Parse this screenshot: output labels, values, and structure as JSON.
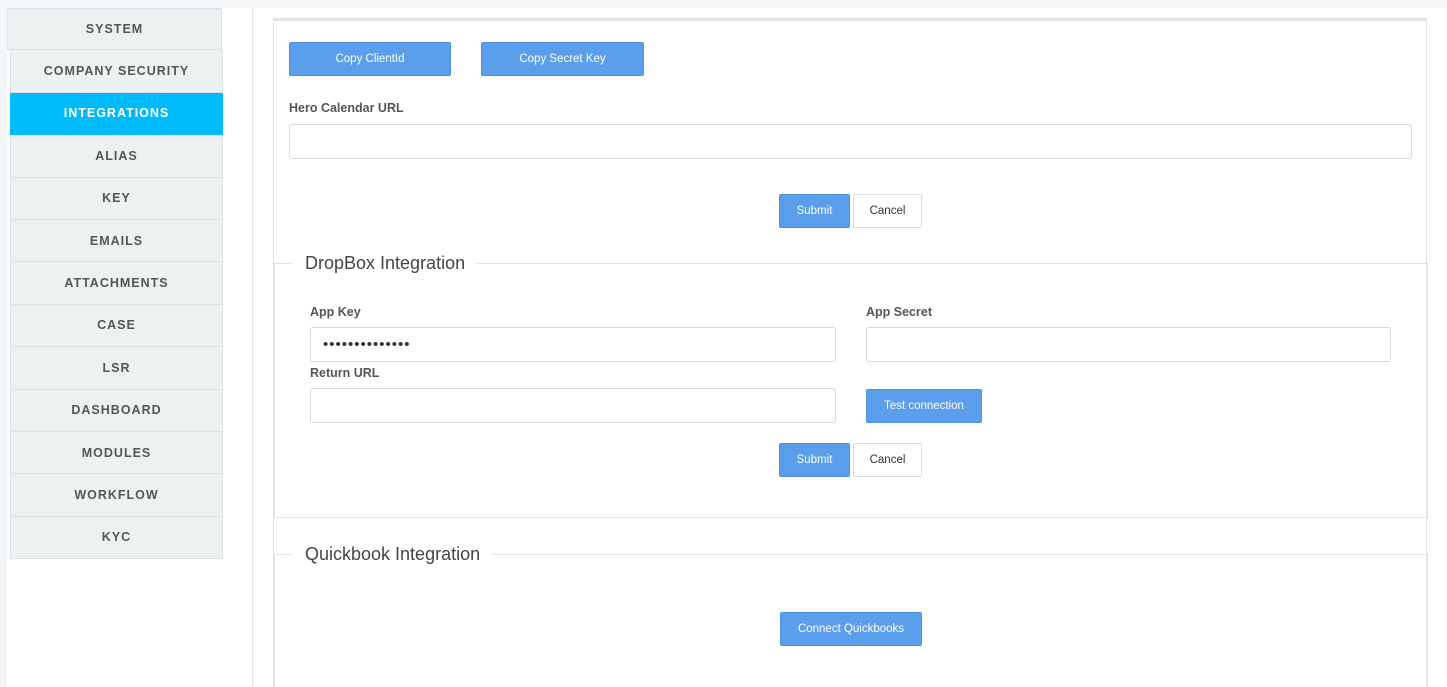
{
  "sidebar": {
    "items": [
      {
        "label": "SYSTEM",
        "active": false
      },
      {
        "label": "COMPANY SECURITY",
        "active": false
      },
      {
        "label": "INTEGRATIONS",
        "active": true
      },
      {
        "label": "ALIAS",
        "active": false
      },
      {
        "label": "KEY",
        "active": false
      },
      {
        "label": "EMAILS",
        "active": false
      },
      {
        "label": "ATTACHMENTS",
        "active": false
      },
      {
        "label": "CASE",
        "active": false
      },
      {
        "label": "LSR",
        "active": false
      },
      {
        "label": "DASHBOARD",
        "active": false
      },
      {
        "label": "MODULES",
        "active": false
      },
      {
        "label": "WORKFLOW",
        "active": false
      },
      {
        "label": "KYC",
        "active": false
      }
    ]
  },
  "hero": {
    "copy_client_id_label": "Copy ClientId",
    "copy_secret_key_label": "Copy Secret Key",
    "calendar_url_label": "Hero Calendar URL",
    "calendar_url_value": "",
    "submit_label": "Submit",
    "cancel_label": "Cancel"
  },
  "dropbox": {
    "title": "DropBox Integration",
    "app_key_label": "App Key",
    "app_key_value": "••••••••••••••",
    "app_secret_label": "App Secret",
    "app_secret_value": "",
    "return_url_label": "Return URL",
    "return_url_value": "",
    "test_connection_label": "Test connection",
    "submit_label": "Submit",
    "cancel_label": "Cancel"
  },
  "quickbook": {
    "title": "Quickbook Integration",
    "connect_label": "Connect Quickbooks"
  },
  "colors": {
    "active_nav": "#00bbf9",
    "primary_button": "#5b9eec"
  }
}
